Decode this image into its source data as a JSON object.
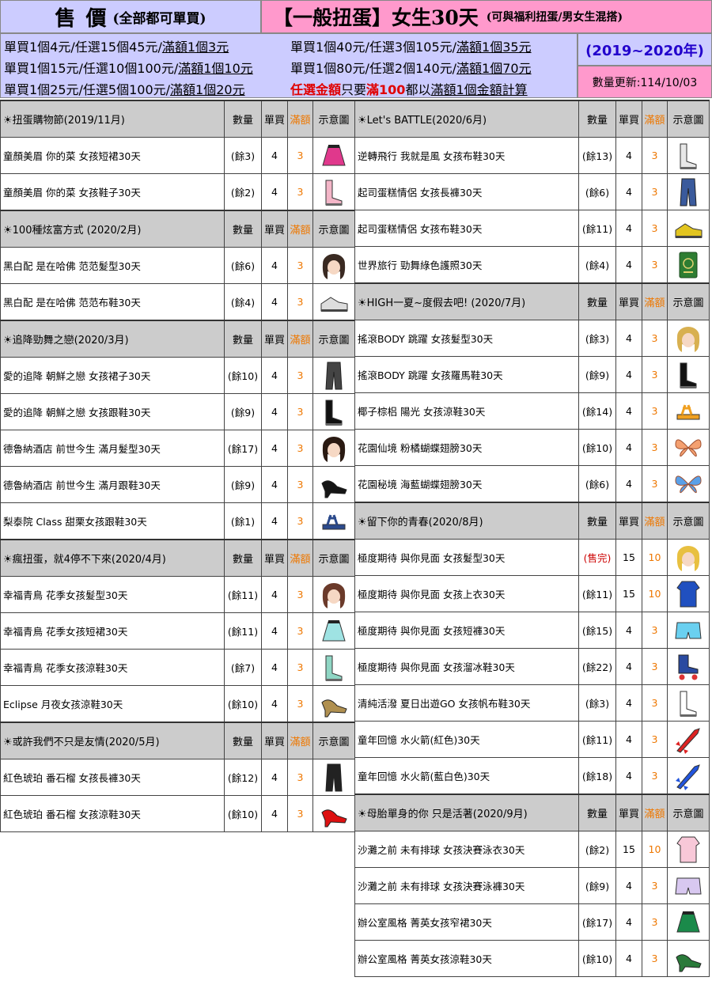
{
  "header": {
    "sale_big": "售 價",
    "sale_small": "(全部都可單買)",
    "title_big": "【一般扭蛋】女生30天",
    "title_small": "(可與福利扭蛋/男女生混搭)",
    "year_range": "(2019~2020年)",
    "updated": "數量更新:114/10/03",
    "prices": {
      "l1_a": "單買1個4元/任選15個45元/",
      "l1_b": "滿額1個3元",
      "l2_a": "單買1個15元/任選10個100元/",
      "l2_b": "滿額1個10元",
      "l3_a": "單買1個25元/任選5個100元/",
      "l3_b": "滿額1個20元",
      "r1_a": "單買1個40元/任選3個105元/",
      "r1_b": "滿額1個35元",
      "r2_a": "單買1個80元/任選2個140元/",
      "r2_b": "滿額1個70元",
      "r3_red1": "任選金額",
      "r3_mid": "只要",
      "r3_red2": "滿100",
      "r3_c": "都以",
      "r3_u": "滿額1個金額計算"
    }
  },
  "columns": {
    "qty": "數量",
    "price": "單買",
    "full": "滿額",
    "img": "示意圖"
  },
  "left_sections": [
    {
      "title": "☀扭蛋購物節(2019/11月)",
      "items": [
        {
          "name": "童顏美眉 你的菜 女孩短裙30天",
          "stock": "(餘3)",
          "price": "4",
          "full": "3",
          "icon": "skirt-icon",
          "color": "#e0388c"
        },
        {
          "name": "童顏美眉 你的菜 女孩鞋子30天",
          "stock": "(餘2)",
          "price": "4",
          "full": "3",
          "icon": "boots-icon",
          "color": "#f4b6c8"
        }
      ]
    },
    {
      "title": "☀100種炫富方式 (2020/2月)",
      "items": [
        {
          "name": "黑白配 是在哈佛 范范髮型30天",
          "stock": "(餘6)",
          "price": "4",
          "full": "3",
          "icon": "hair-icon",
          "color": "#3a2a22"
        },
        {
          "name": "黑白配 是在哈佛 范范布鞋30天",
          "stock": "(餘4)",
          "price": "4",
          "full": "3",
          "icon": "sneaker-icon",
          "color": "#dddddd"
        }
      ]
    },
    {
      "title": "☀追降勁舞之戀(2020/3月)",
      "items": [
        {
          "name": "愛的追降 朝鮮之戀 女孩裙子30天",
          "stock": "(餘10)",
          "price": "4",
          "full": "3",
          "icon": "pants-icon",
          "color": "#444444"
        },
        {
          "name": "愛的追降 朝鮮之戀 女孩跟鞋30天",
          "stock": "(餘9)",
          "price": "4",
          "full": "3",
          "icon": "boots-icon",
          "color": "#111111"
        },
        {
          "name": "德魯納酒店 前世今生 滿月髮型30天",
          "stock": "(餘17)",
          "price": "4",
          "full": "3",
          "icon": "hair-icon",
          "color": "#2a1a12"
        },
        {
          "name": "德魯納酒店 前世今生 滿月跟鞋30天",
          "stock": "(餘9)",
          "price": "4",
          "full": "3",
          "icon": "heels-icon",
          "color": "#151515"
        },
        {
          "name": "梨泰院 Class 甜栗女孩跟鞋30天",
          "stock": "(餘1)",
          "price": "4",
          "full": "3",
          "icon": "sandal-icon",
          "color": "#2b4a8c"
        }
      ]
    },
    {
      "title": "☀瘋扭蛋，就4停不下來(2020/4月)",
      "items": [
        {
          "name": "幸福青鳥 花季女孩髮型30天",
          "stock": "(餘11)",
          "price": "4",
          "full": "3",
          "icon": "hair-icon",
          "color": "#6b3a2a"
        },
        {
          "name": "幸福青鳥 花季女孩短裙30天",
          "stock": "(餘11)",
          "price": "4",
          "full": "3",
          "icon": "skirt-icon",
          "color": "#9fe3e3"
        },
        {
          "name": "幸福青鳥 花季女孩涼鞋30天",
          "stock": "(餘7)",
          "price": "4",
          "full": "3",
          "icon": "boots-icon",
          "color": "#8fd6c4"
        },
        {
          "name": "Eclipse 月夜女孩涼鞋30天",
          "stock": "(餘10)",
          "price": "4",
          "full": "3",
          "icon": "heels-icon",
          "color": "#b09050"
        }
      ]
    },
    {
      "title": "☀或許我們不只是友情(2020/5月)",
      "items": [
        {
          "name": "紅色琥珀 番石榴 女孩長褲30天",
          "stock": "(餘12)",
          "price": "4",
          "full": "3",
          "icon": "pants-icon",
          "color": "#222222"
        },
        {
          "name": "紅色琥珀 番石榴 女孩涼鞋30天",
          "stock": "(餘10)",
          "price": "4",
          "full": "3",
          "icon": "heels-icon",
          "color": "#dd1111"
        }
      ]
    }
  ],
  "right_sections": [
    {
      "title": "☀Let's BATTLE(2020/6月)",
      "items": [
        {
          "name": "逆轉飛行 我就是風 女孩布鞋30天",
          "stock": "(餘13)",
          "price": "4",
          "full": "3",
          "icon": "boots-icon",
          "color": "#e8e8e8"
        },
        {
          "name": "起司蛋糕情侶 女孩長褲30天",
          "stock": "(餘6)",
          "price": "4",
          "full": "3",
          "icon": "pants-icon",
          "color": "#3a5a9c"
        },
        {
          "name": "起司蛋糕情侶 女孩布鞋30天",
          "stock": "(餘11)",
          "price": "4",
          "full": "3",
          "icon": "sneaker-icon",
          "color": "#e2c520"
        },
        {
          "name": "世界旅行 勁舞綠色護照30天",
          "stock": "(餘4)",
          "price": "4",
          "full": "3",
          "icon": "passport-icon",
          "color": "#2e7d32"
        }
      ]
    },
    {
      "title": "☀HIGH一夏~度假去吧! (2020/7月)",
      "items": [
        {
          "name": "搖滾BODY 跳躍 女孩髮型30天",
          "stock": "(餘3)",
          "price": "4",
          "full": "3",
          "icon": "hair-icon",
          "color": "#d8b050"
        },
        {
          "name": "搖滾BODY 跳躍 女孩羅馬鞋30天",
          "stock": "(餘9)",
          "price": "4",
          "full": "3",
          "icon": "boots-icon",
          "color": "#111111"
        },
        {
          "name": "椰子棕梠 陽光 女孩涼鞋30天",
          "stock": "(餘14)",
          "price": "4",
          "full": "3",
          "icon": "sandal-icon",
          "color": "#f0a020"
        },
        {
          "name": "花園仙境 粉橘蝴蝶翅膀30天",
          "stock": "(餘10)",
          "price": "4",
          "full": "3",
          "icon": "wings-icon",
          "color": "#f4a070"
        },
        {
          "name": "花園秘境 海藍蝴蝶翅膀30天",
          "stock": "(餘6)",
          "price": "4",
          "full": "3",
          "icon": "wings-icon",
          "color": "#5aa0e8"
        }
      ]
    },
    {
      "title": "☀留下你的青春(2020/8月)",
      "items": [
        {
          "name": "極度期待 與你見面 女孩髮型30天",
          "stock": "(售完)",
          "sold": true,
          "price": "15",
          "full": "10",
          "icon": "hair-icon",
          "color": "#e8c040"
        },
        {
          "name": "極度期待 與你見面 女孩上衣30天",
          "stock": "(餘11)",
          "price": "15",
          "full": "10",
          "icon": "top-icon",
          "color": "#2050c0"
        },
        {
          "name": "極度期待 與你見面 女孩短褲30天",
          "stock": "(餘15)",
          "price": "4",
          "full": "3",
          "icon": "shorts-icon",
          "color": "#6ad0f0"
        },
        {
          "name": "極度期待 與你見面 女孩溜冰鞋30天",
          "stock": "(餘22)",
          "price": "4",
          "full": "3",
          "icon": "skate-icon",
          "color": "#2a4aa0"
        },
        {
          "name": "清純活潑 夏日出遊GO 女孩帆布鞋30天",
          "stock": "(餘3)",
          "price": "4",
          "full": "3",
          "icon": "boots-icon",
          "color": "#ffffff"
        },
        {
          "name": "童年回憶 水火箭(紅色)30天",
          "stock": "(餘11)",
          "price": "4",
          "full": "3",
          "icon": "rocket-icon",
          "color": "#dd2222"
        },
        {
          "name": "童年回憶 水火箭(藍白色)30天",
          "stock": "(餘18)",
          "price": "4",
          "full": "3",
          "icon": "rocket-icon",
          "color": "#2255dd"
        }
      ]
    },
    {
      "title": "☀母胎單身的你 只是活著(2020/9月)",
      "items": [
        {
          "name": "沙灘之前 未有排球 女孩決賽泳衣30天",
          "stock": "(餘2)",
          "price": "15",
          "full": "10",
          "icon": "top-icon",
          "color": "#f8c8d8"
        },
        {
          "name": "沙灘之前 未有排球 女孩決賽泳褲30天",
          "stock": "(餘9)",
          "price": "4",
          "full": "3",
          "icon": "shorts-icon",
          "color": "#d8c8f0"
        },
        {
          "name": "辦公室風格 菁英女孩窄裙30天",
          "stock": "(餘17)",
          "price": "4",
          "full": "3",
          "icon": "skirt-icon",
          "color": "#1a8a4a"
        },
        {
          "name": "辦公室風格 菁英女孩涼鞋30天",
          "stock": "(餘10)",
          "price": "4",
          "full": "3",
          "icon": "heels-icon",
          "color": "#2a7a3a"
        }
      ]
    }
  ]
}
